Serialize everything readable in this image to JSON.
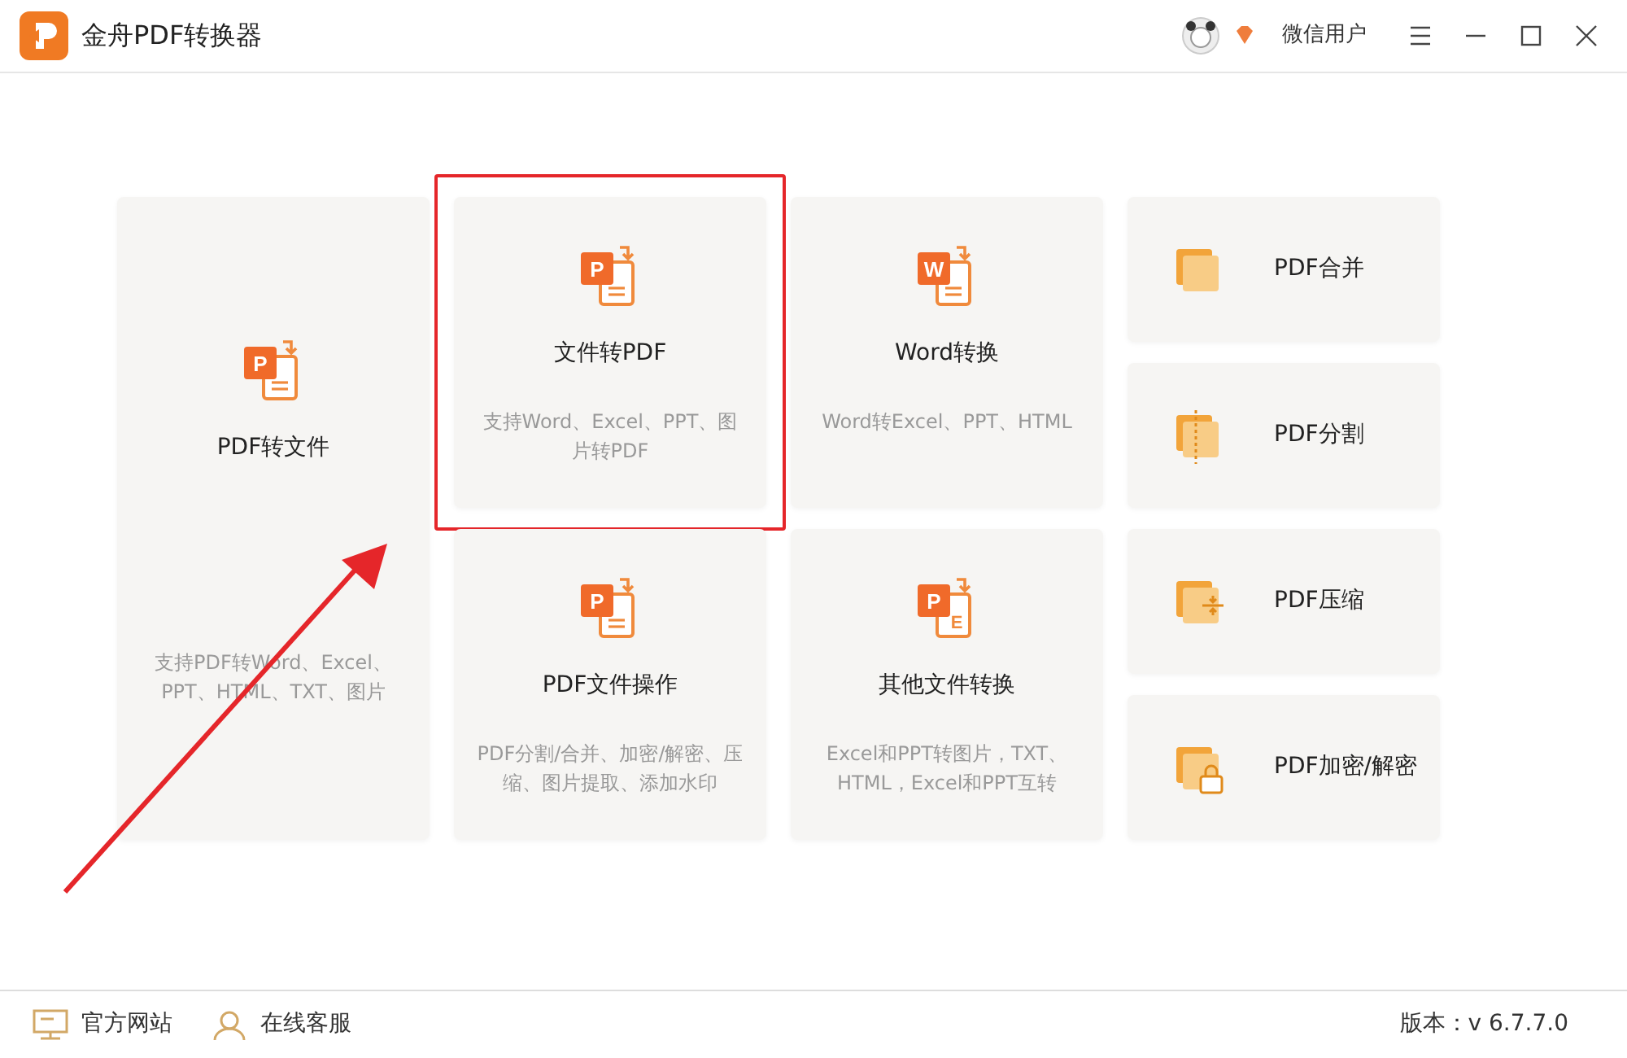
{
  "window": {
    "title": "金舟PDF转换器"
  },
  "user": {
    "name": "微信用户"
  },
  "tools": [
    {
      "kind": "tall",
      "title": "PDF转文件",
      "desc": "支持PDF转Word、Excel、PPT、HTML、TXT、图片",
      "icon_text": [
        "P"
      ],
      "highlighted": false
    },
    {
      "kind": "medium",
      "title": "文件转PDF",
      "desc": "支持Word、Excel、PPT、图片转PDF",
      "icon_text": [
        "P"
      ],
      "highlighted": true
    },
    {
      "kind": "medium",
      "title": "Word转换",
      "desc": "Word转Excel、PPT、HTML",
      "icon_text": [
        "W"
      ],
      "highlighted": false
    },
    {
      "kind": "small",
      "title": "PDF合并",
      "highlighted": false
    },
    {
      "kind": "small",
      "title": "PDF分割",
      "highlighted": false
    },
    {
      "kind": "medium",
      "title": "PDF文件操作",
      "desc": "PDF分割/合并、加密/解密、压缩、图片提取、添加水印",
      "icon_text": [
        "P"
      ],
      "highlighted": false
    },
    {
      "kind": "medium",
      "title": "其他文件转换",
      "desc": "Excel和PPT转图片，TXT、HTML，Excel和PPT互转",
      "icon_text": [
        "P",
        "E"
      ],
      "highlighted": false
    },
    {
      "kind": "small",
      "title": "PDF压缩",
      "highlighted": false
    },
    {
      "kind": "small",
      "title": "PDF加密/解密",
      "highlighted": false
    }
  ],
  "footer": {
    "links": [
      {
        "label": "官方网站"
      },
      {
        "label": "在线客服"
      }
    ],
    "version": "版本：v 6.7.7.0"
  }
}
